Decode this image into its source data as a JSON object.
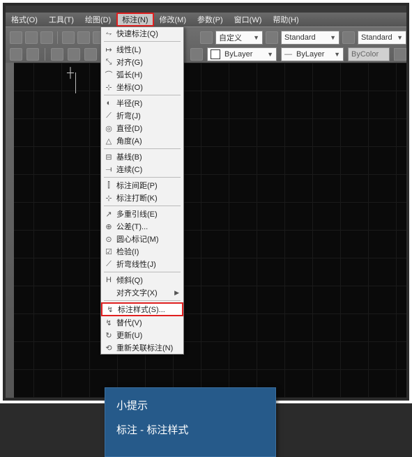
{
  "menubar": {
    "items": [
      "格式(O)",
      "工具(T)",
      "绘图(D)",
      "标注(N)",
      "修改(M)",
      "参数(P)",
      "窗口(W)",
      "帮助(H)"
    ],
    "active_index": 3
  },
  "toolbar": {
    "custom_label": "自定义",
    "standard1": "Standard",
    "standard2": "Standard",
    "bylayer1": "ByLayer",
    "bylayer2": "ByLayer",
    "bycolor": "ByColor"
  },
  "dropdown": {
    "groups": [
      [
        {
          "icon": "⥊",
          "label": "快速标注(Q)"
        }
      ],
      [
        {
          "icon": "↦",
          "label": "线性(L)"
        },
        {
          "icon": "⤡",
          "label": "对齐(G)"
        },
        {
          "icon": "⌒",
          "label": "弧长(H)"
        },
        {
          "icon": "⊹",
          "label": "坐标(O)"
        }
      ],
      [
        {
          "icon": "◐",
          "label": "半径(R)"
        },
        {
          "icon": "⟋",
          "label": "折弯(J)"
        },
        {
          "icon": "◎",
          "label": "直径(D)"
        },
        {
          "icon": "△",
          "label": "角度(A)"
        }
      ],
      [
        {
          "icon": "⊟",
          "label": "基线(B)"
        },
        {
          "icon": "⟞",
          "label": "连续(C)"
        }
      ],
      [
        {
          "icon": "⫿",
          "label": "标注间距(P)"
        },
        {
          "icon": "⊹",
          "label": "标注打断(K)"
        }
      ],
      [
        {
          "icon": "↗",
          "label": "多重引线(E)"
        },
        {
          "icon": "⊕",
          "label": "公差(T)..."
        },
        {
          "icon": "⊙",
          "label": "圆心标记(M)"
        },
        {
          "icon": "☑",
          "label": "检验(I)"
        },
        {
          "icon": "⟋",
          "label": "折弯线性(J)"
        }
      ],
      [
        {
          "icon": "H",
          "label": "倾斜(Q)"
        },
        {
          "icon": "",
          "label": "对齐文字(X)",
          "submenu": true
        }
      ],
      [
        {
          "icon": "↯",
          "label": "标注样式(S)...",
          "highlight": true
        },
        {
          "icon": "↯",
          "label": "替代(V)"
        },
        {
          "icon": "↻",
          "label": "更新(U)"
        },
        {
          "icon": "⟲",
          "label": "重新关联标注(N)"
        }
      ]
    ]
  },
  "tip": {
    "title": "小提示",
    "body": "标注 - 标注样式"
  }
}
